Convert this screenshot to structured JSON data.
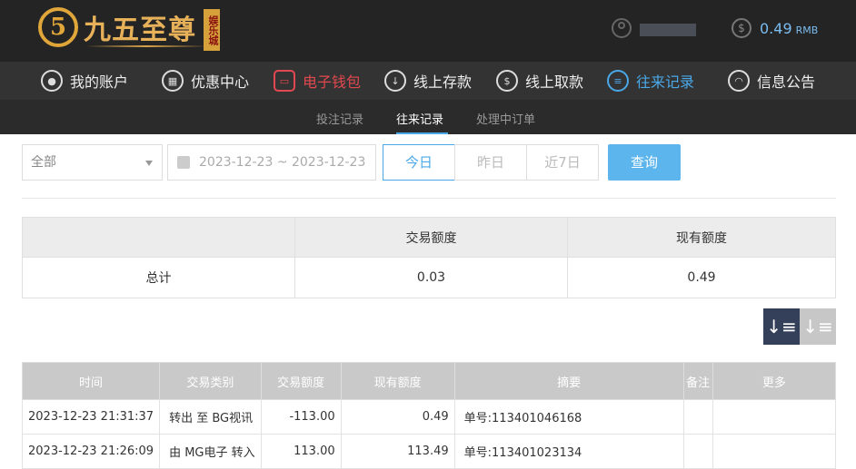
{
  "header": {
    "logo_text": "九五至尊",
    "logo_badge": "娱乐城",
    "balance": "0.49",
    "currency": "RMB"
  },
  "nav": [
    {
      "label": "我的账户",
      "icon": "user-circle-icon"
    },
    {
      "label": "优惠中心",
      "icon": "gift-icon"
    },
    {
      "label": "电子钱包",
      "icon": "wallet-icon"
    },
    {
      "label": "线上存款",
      "icon": "deposit-icon"
    },
    {
      "label": "线上取款",
      "icon": "withdraw-icon"
    },
    {
      "label": "往来记录",
      "icon": "records-icon"
    },
    {
      "label": "信息公告",
      "icon": "bell-icon"
    }
  ],
  "subnav": [
    "投注记录",
    "往来记录",
    "处理中订单"
  ],
  "filters": {
    "type_selected": "全部",
    "date_range": "2023-12-23 ~ 2023-12-23",
    "quick": [
      "今日",
      "昨日",
      "近7日"
    ],
    "query_label": "查询"
  },
  "summary": {
    "headers": [
      "",
      "交易额度",
      "现有额度"
    ],
    "row": [
      "总计",
      "0.03",
      "0.49"
    ]
  },
  "records": {
    "headers": [
      "时间",
      "交易类别",
      "交易额度",
      "现有额度",
      "摘要",
      "备注",
      "更多"
    ],
    "rows": [
      [
        "2023-12-23 21:31:37",
        "转出 至 BG视讯",
        "-113.00",
        "0.49",
        "单号:113401046168",
        "",
        ""
      ],
      [
        "2023-12-23 21:26:09",
        "由 MG电子 转入",
        "113.00",
        "113.49",
        "单号:113401023134",
        "",
        ""
      ]
    ]
  },
  "colors": {
    "accent": "#4aa8e8",
    "active_nav": "#e2484f",
    "header_bg": "#242424"
  }
}
